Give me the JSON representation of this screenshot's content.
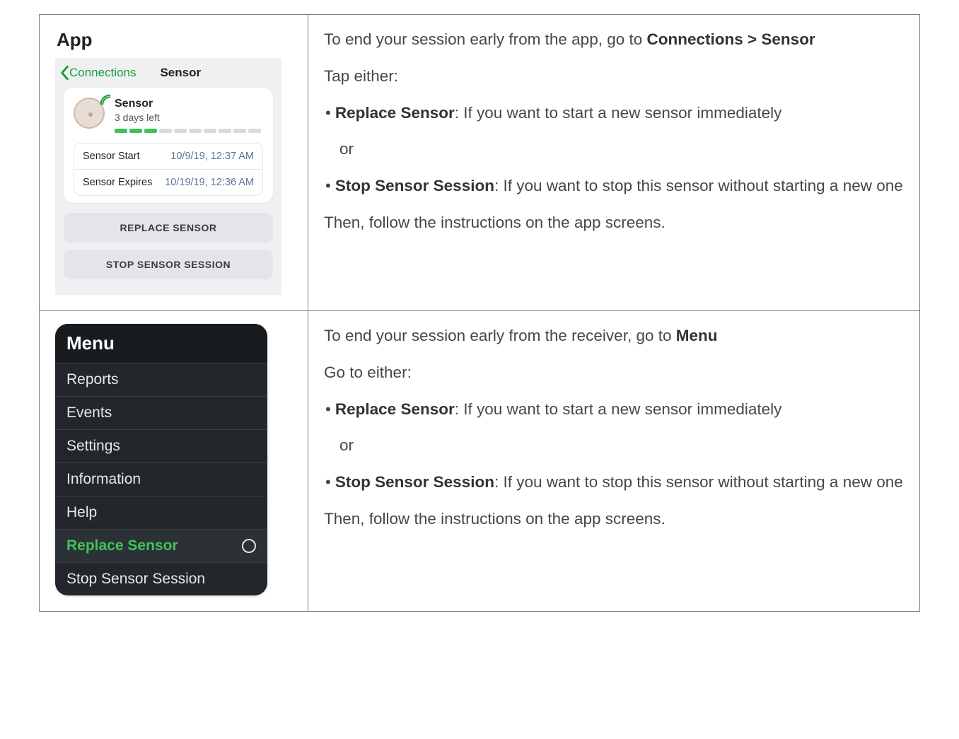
{
  "app": {
    "heading": "App",
    "nav_back": "Connections",
    "nav_title": "Sensor",
    "sensor_name": "Sensor",
    "sensor_sub": "3 days left",
    "rows": [
      {
        "label": "Sensor Start",
        "value": "10/9/19, 12:37 AM"
      },
      {
        "label": "Sensor Expires",
        "value": "10/19/19, 12:36 AM"
      }
    ],
    "btn_replace": "REPLACE SENSOR",
    "btn_stop": "STOP SENSOR SESSION"
  },
  "app_instructions": {
    "intro_a": "To end your session early from the app, go to ",
    "intro_b": "Connections > Sensor",
    "tap_either": "Tap either:",
    "b1_bold": "Replace Sensor",
    "b1_rest": ": If you want to start a new sensor immediately",
    "or": "or",
    "b2_bold": "Stop Sensor Session",
    "b2_rest": ": If you want to stop this sensor without starting a new one",
    "then": "Then, follow the instructions on the app screens."
  },
  "receiver": {
    "menu_title": "Menu",
    "items": [
      {
        "label": "Reports",
        "selected": false
      },
      {
        "label": "Events",
        "selected": false
      },
      {
        "label": "Settings",
        "selected": false
      },
      {
        "label": "Information",
        "selected": false
      },
      {
        "label": "Help",
        "selected": false
      },
      {
        "label": "Replace Sensor",
        "selected": true
      },
      {
        "label": "Stop Sensor Session",
        "selected": false
      }
    ]
  },
  "rx_instructions": {
    "intro_a": "To end your session early from the receiver, go to ",
    "intro_b": "Menu",
    "go_either": "Go to either:",
    "b1_bold": "Replace Sensor",
    "b1_rest": ": If you want to start a new sensor immediately",
    "or": "or",
    "b2_bold": "Stop Sensor Session",
    "b2_rest": ": If you want to stop this sensor without starting a new one",
    "then": "Then, follow the instructions on the app screens."
  }
}
